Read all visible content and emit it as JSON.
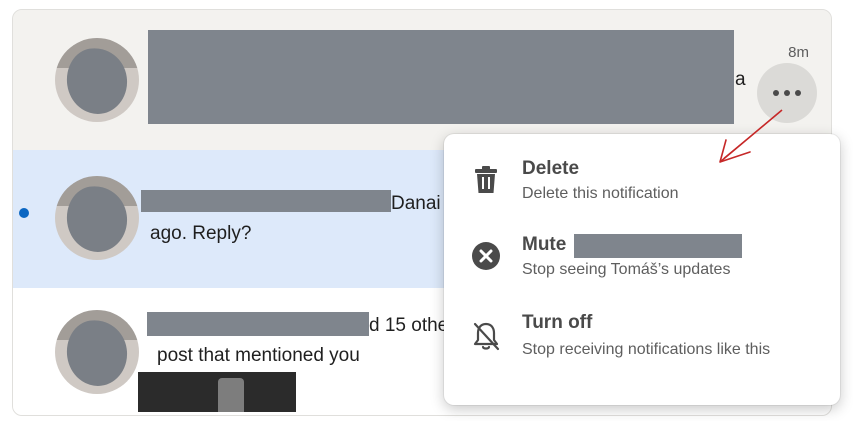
{
  "notifications": [
    {
      "visible_fragment": "a",
      "time": "8m",
      "more_label": "•••"
    },
    {
      "visible_name": "Danai",
      "body": "ago. Reply?"
    },
    {
      "visible_fragment": "d 15 othe",
      "body": "post that mentioned you"
    }
  ],
  "menu": {
    "items": [
      {
        "title": "Delete",
        "desc": "Delete this notification",
        "icon": "trash-icon"
      },
      {
        "title": "Mute",
        "desc": "Stop seeing Tomáš’s updates",
        "icon": "mute-x-icon"
      },
      {
        "title": "Turn off",
        "desc": "Stop receiving notifications like this",
        "icon": "bell-off-icon"
      }
    ]
  },
  "colors": {
    "unread_bg": "#dde9fa",
    "unread_dot": "#0a66c2",
    "annotation_arrow": "#c62828"
  }
}
